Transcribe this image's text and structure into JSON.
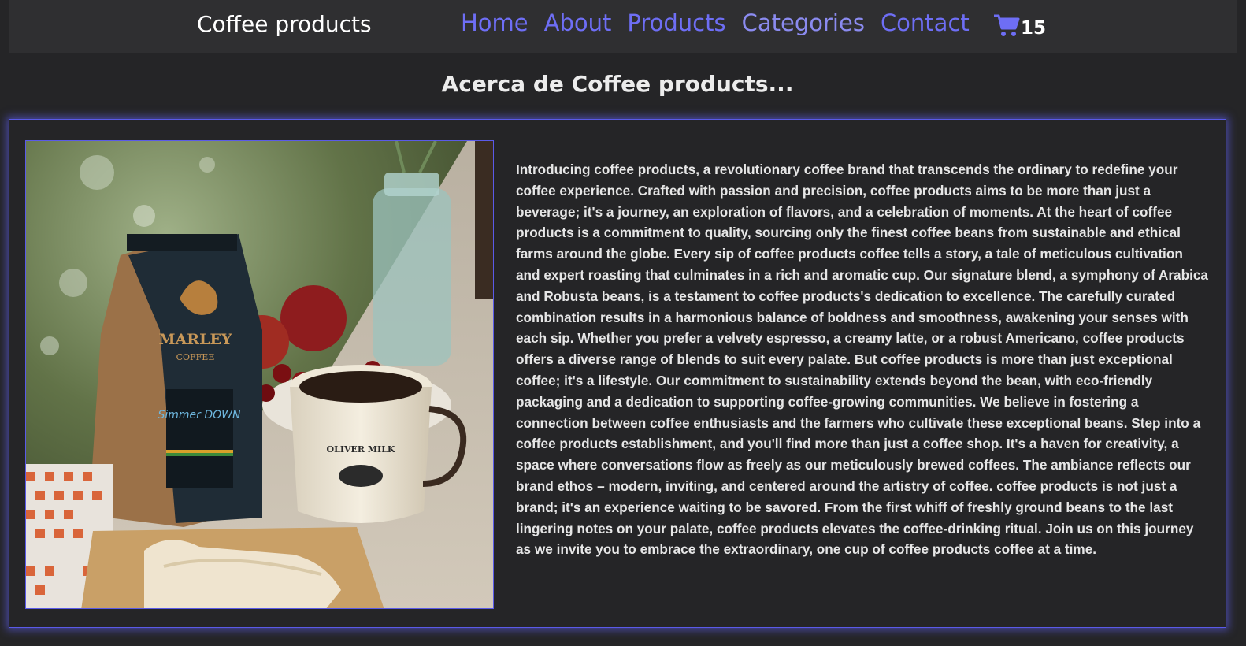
{
  "nav": {
    "brand": "Coffee products",
    "links": [
      {
        "label": "Home"
      },
      {
        "label": "About"
      },
      {
        "label": "Products"
      },
      {
        "label": "Categories"
      },
      {
        "label": "Contact"
      }
    ],
    "cart_icon": "shopping-cart-icon",
    "cart_count": "15"
  },
  "page": {
    "title": "Acerca de Coffee products..."
  },
  "about": {
    "image_label": "coffee-bag-and-mug-photo",
    "bag_brand": "MARLEY",
    "bag_sub": "COFFEE",
    "bag_product": "Simmer DOWN",
    "mug_text": "OLIVER MILK",
    "text": "Introducing coffee products, a revolutionary coffee brand that transcends the ordinary to redefine your coffee experience. Crafted with passion and precision, coffee products aims to be more than just a beverage; it's a journey, an exploration of flavors, and a celebration of moments. At the heart of coffee products is a commitment to quality, sourcing only the finest coffee beans from sustainable and ethical farms around the globe. Every sip of coffee products coffee tells a story, a tale of meticulous cultivation and expert roasting that culminates in a rich and aromatic cup. Our signature blend, a symphony of Arabica and Robusta beans, is a testament to coffee products's dedication to excellence. The carefully curated combination results in a harmonious balance of boldness and smoothness, awakening your senses with each sip. Whether you prefer a velvety espresso, a creamy latte, or a robust Americano, coffee products offers a diverse range of blends to suit every palate. But coffee products is more than just exceptional coffee; it's a lifestyle. Our commitment to sustainability extends beyond the bean, with eco-friendly packaging and a dedication to supporting coffee-growing communities. We believe in fostering a connection between coffee enthusiasts and the farmers who cultivate these exceptional beans. Step into a coffee products establishment, and you'll find more than just a coffee shop. It's a haven for creativity, a space where conversations flow as freely as our meticulously brewed coffees. The ambiance reflects our brand ethos – modern, inviting, and centered around the artistry of coffee. coffee products is not just a brand; it's an experience waiting to be savored. From the first whiff of freshly ground beans to the last lingering notes on your palate, coffee products elevates the coffee-drinking ritual. Join us on this journey as we invite you to embrace the extraordinary, one cup of coffee products coffee at a time."
  },
  "colors": {
    "background": "#252527",
    "navbar": "#2f2f31",
    "link": "#6e6ef5",
    "accent_glow": "#5a5ae8",
    "text": "#e6e6e6"
  }
}
